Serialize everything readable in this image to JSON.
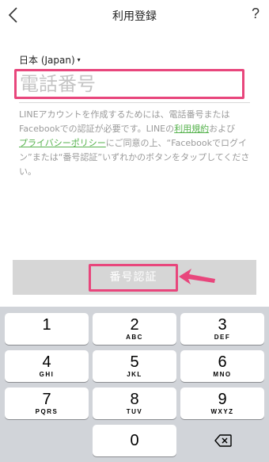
{
  "nav": {
    "back_icon": "chevron-left-icon",
    "title": "利用登録",
    "help": "?"
  },
  "form": {
    "country": "日本 (Japan)",
    "country_caret": "▾",
    "phone_placeholder": "電話番号",
    "phone_value": ""
  },
  "terms": {
    "part1": "LINEアカウントを作成するためには、電話番号または Facebookでの認証が必要です。LINEの",
    "link_terms": "利用規約",
    "part2": "および",
    "link_privacy": "プライバシーポリシー",
    "part3": "にご同意の上、“Facebookでログイン”または“番号認証”いずれかのボタンをタップしてください。"
  },
  "verify_button": "番号認証",
  "colors": {
    "highlight": "#e8467c",
    "link": "#55b24c"
  },
  "keypad": {
    "keys": [
      {
        "num": "1",
        "letters": ""
      },
      {
        "num": "2",
        "letters": "ABC"
      },
      {
        "num": "3",
        "letters": "DEF"
      },
      {
        "num": "4",
        "letters": "GHI"
      },
      {
        "num": "5",
        "letters": "JKL"
      },
      {
        "num": "6",
        "letters": "MNO"
      },
      {
        "num": "7",
        "letters": "PQRS"
      },
      {
        "num": "8",
        "letters": "TUV"
      },
      {
        "num": "9",
        "letters": "WXYZ"
      },
      {
        "num": "0",
        "letters": ""
      }
    ],
    "delete_icon": "backspace-icon"
  }
}
